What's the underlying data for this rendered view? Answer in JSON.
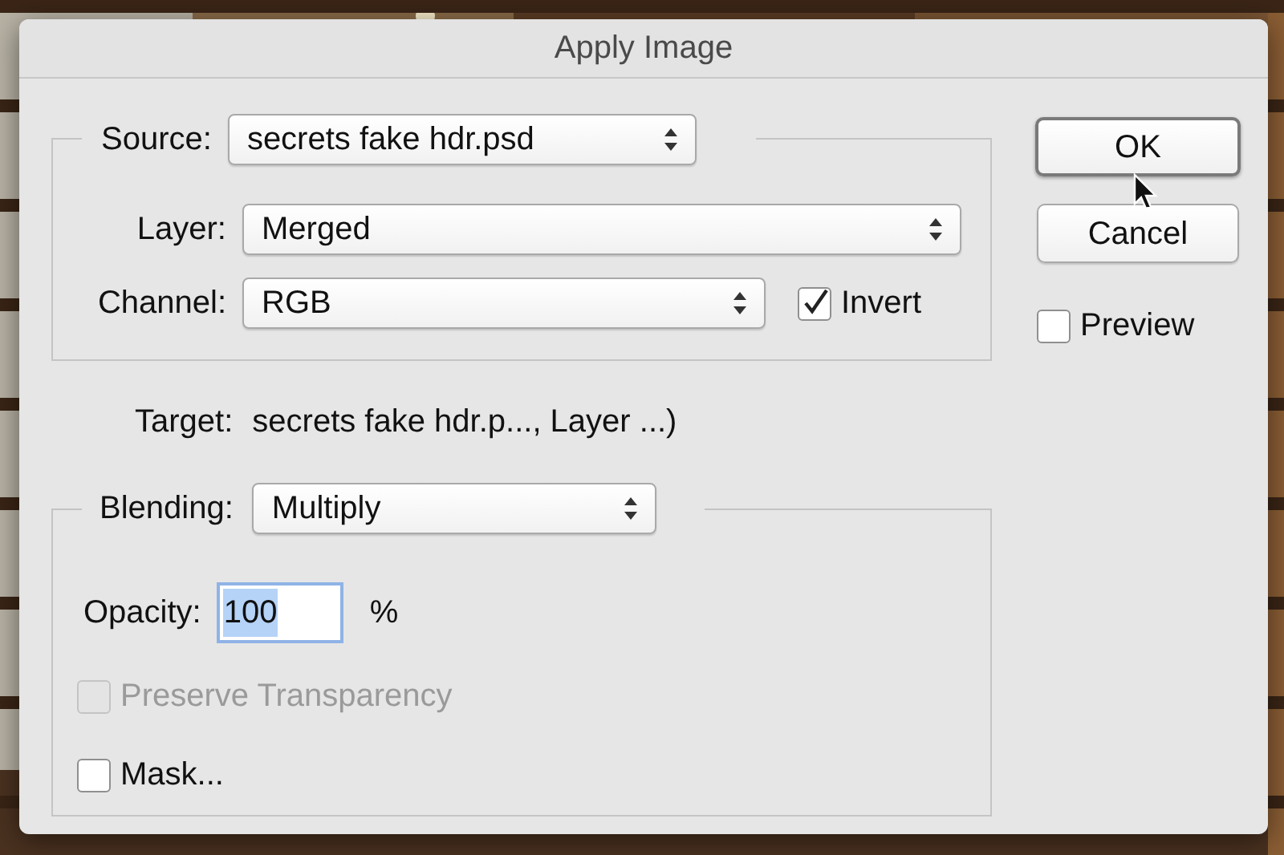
{
  "window": {
    "title": "Apply Image"
  },
  "source": {
    "label": "Source:",
    "value": "secrets fake hdr.psd"
  },
  "layer": {
    "label": "Layer:",
    "value": "Merged"
  },
  "channel": {
    "label": "Channel:",
    "value": "RGB"
  },
  "invert": {
    "label": "Invert",
    "checked": true
  },
  "target": {
    "label": "Target:",
    "value": "secrets fake hdr.p..., Layer ...)"
  },
  "blending": {
    "label": "Blending:",
    "value": "Multiply"
  },
  "opacity": {
    "label": "Opacity:",
    "value": "100",
    "unit": "%",
    "highlighted": true
  },
  "checkboxes": [
    {
      "label": "Preserve Transparency",
      "checked": false,
      "disabled": true
    },
    {
      "label": "Mask...",
      "checked": false,
      "disabled": false
    }
  ],
  "buttons": [
    {
      "label": "OK",
      "default": true
    },
    {
      "label": "Cancel",
      "default": false
    }
  ],
  "preview": {
    "label": "Preview",
    "checked": false
  }
}
